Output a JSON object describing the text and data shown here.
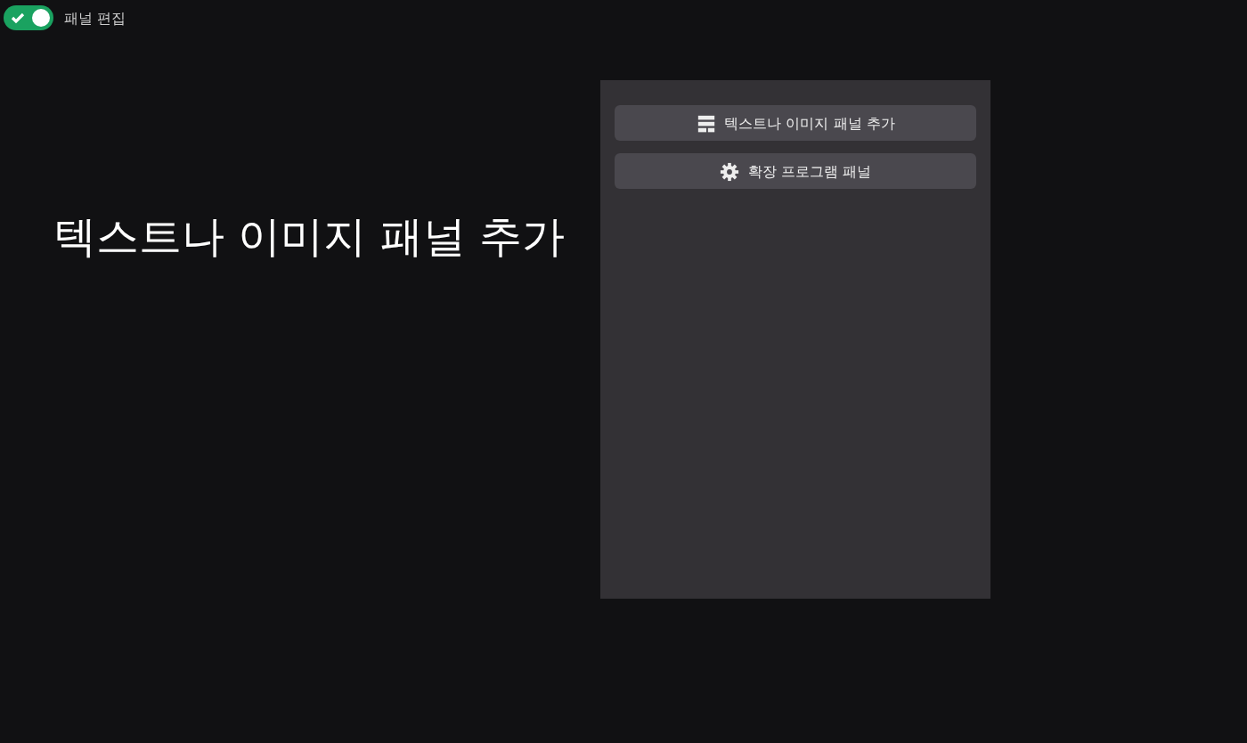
{
  "toggle": {
    "label": "패널 편집",
    "on": true
  },
  "caption": "텍스트나 이미지 패널 추가",
  "panel": {
    "buttons": [
      {
        "kind": "text-image",
        "label": "텍스트나 이미지 패널 추가"
      },
      {
        "kind": "extension",
        "label": "확장 프로그램 패널"
      }
    ]
  }
}
